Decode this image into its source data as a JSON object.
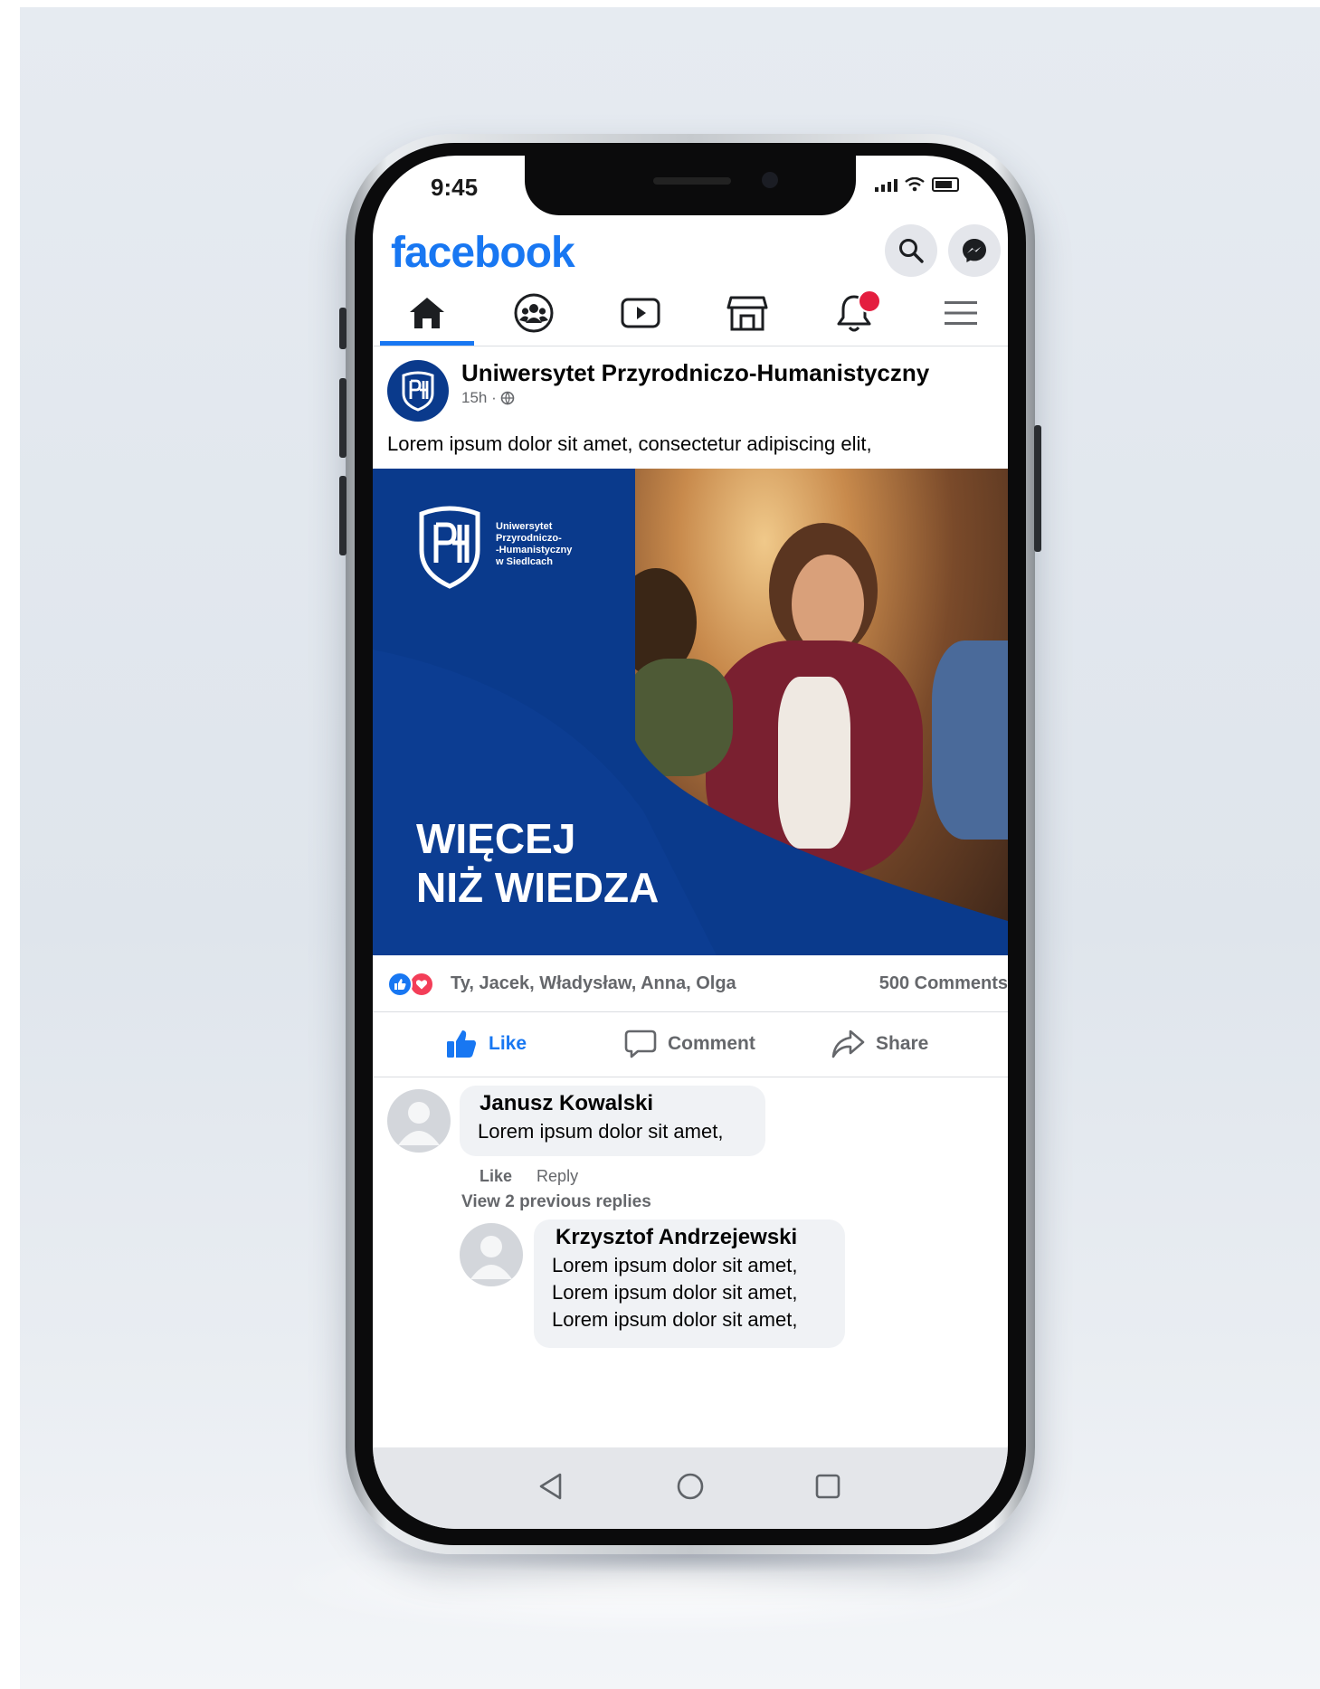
{
  "status_bar": {
    "time": "9:45"
  },
  "header": {
    "logo_text": "facebook",
    "search_icon": "search-icon",
    "messenger_icon": "messenger-icon"
  },
  "tabs": [
    {
      "name": "home",
      "icon": "home-icon",
      "active": true
    },
    {
      "name": "groups",
      "icon": "groups-icon",
      "active": false
    },
    {
      "name": "watch",
      "icon": "video-icon",
      "active": false
    },
    {
      "name": "marketplace",
      "icon": "store-icon",
      "active": false
    },
    {
      "name": "notifications",
      "icon": "bell-icon",
      "active": false
    },
    {
      "name": "menu",
      "icon": "menu-icon",
      "active": false
    }
  ],
  "post": {
    "author": "Uniwersytet Przyrodniczo-Humanistyczny",
    "time": "15h ·",
    "text": "Lorem ipsum dolor sit amet, consectetur adipiscing elit,",
    "image": {
      "logo_lines": [
        "Uniwersytet",
        "Przyrodniczo-",
        "-Humanistyczny",
        "w Siedlcach"
      ],
      "slogan_line1": "WIĘCEJ",
      "slogan_line2": "NIŻ WIEDZA"
    },
    "reactions_names": "Ty, Jacek, Władysław, Anna, Olga",
    "comments_count": "500 Comments",
    "actions": {
      "like": "Like",
      "comment": "Comment",
      "share": "Share"
    }
  },
  "comments": [
    {
      "author": "Janusz Kowalski",
      "text": "Lorem ipsum dolor sit amet,",
      "like": "Like",
      "reply": "Reply",
      "view_previous": "View 2 previous replies"
    },
    {
      "author": "Krzysztof Andrzejewski",
      "lines": [
        "Lorem ipsum dolor sit amet,",
        "Lorem ipsum dolor sit amet,",
        "Lorem ipsum dolor sit amet,"
      ]
    }
  ],
  "colors": {
    "brand": "#1877f2",
    "university_blue": "#0a3a8c",
    "badge_red": "#e41e3f"
  }
}
